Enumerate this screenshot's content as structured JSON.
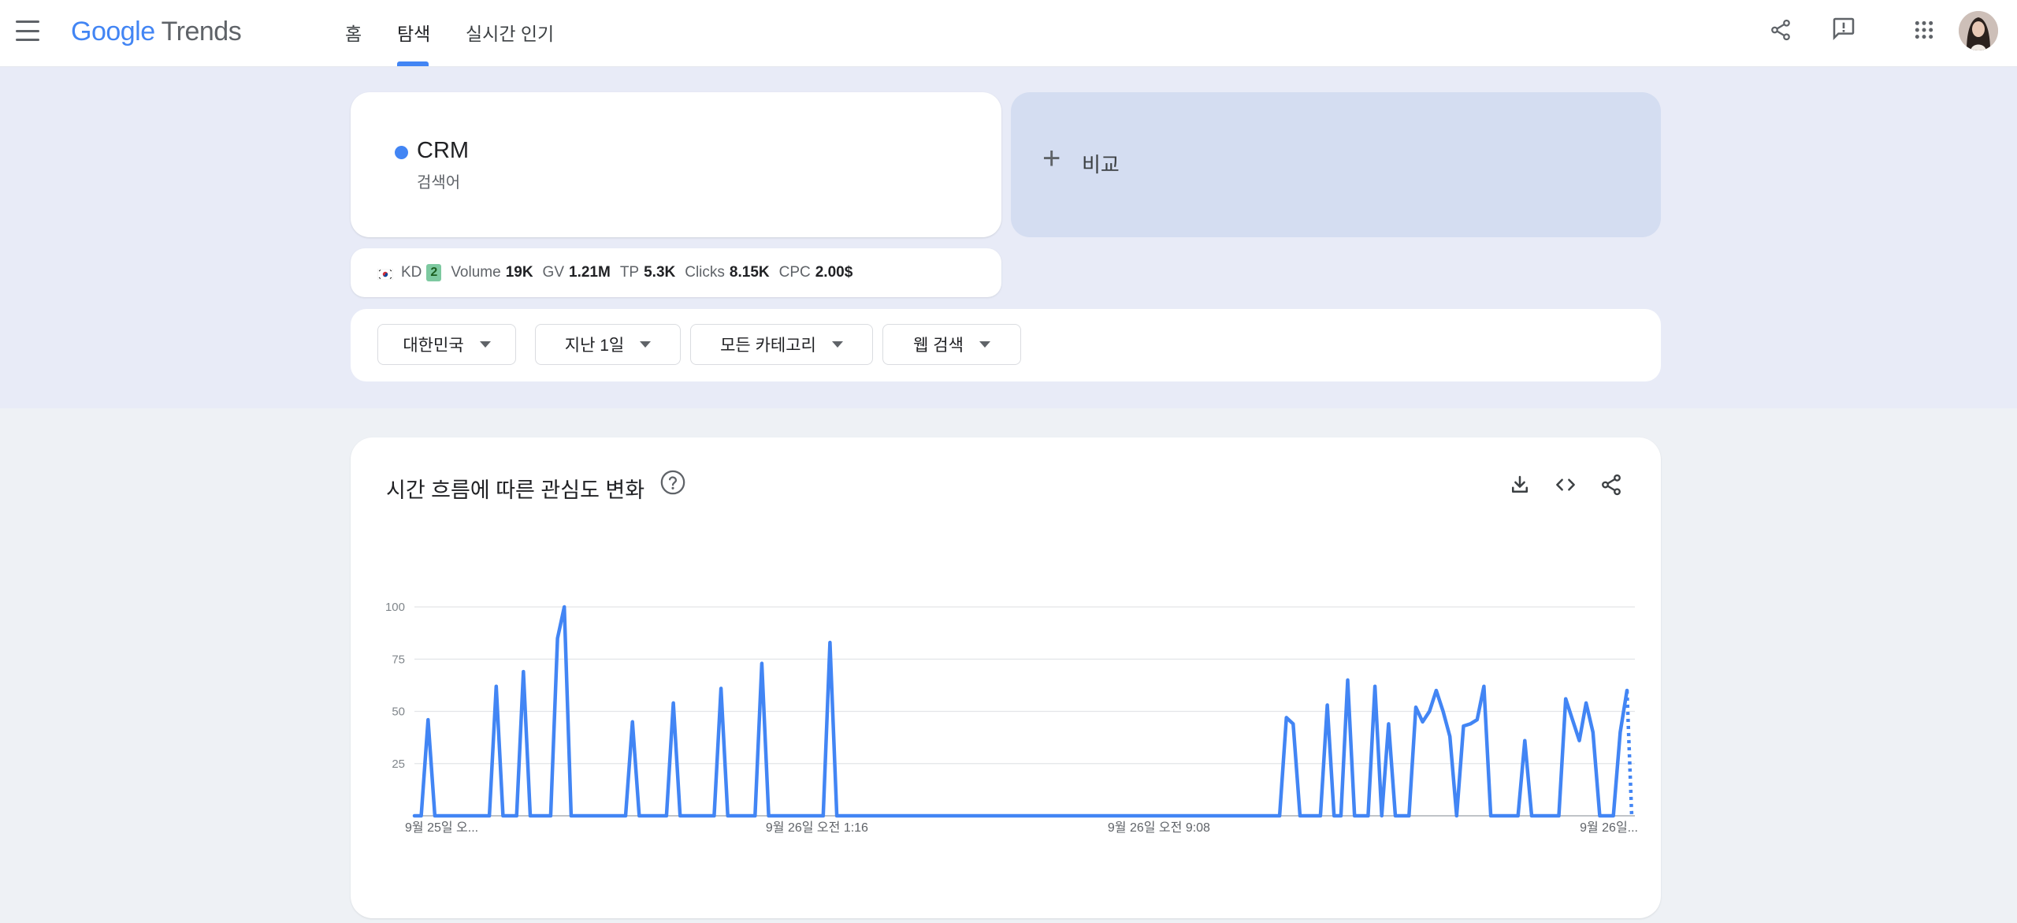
{
  "header": {
    "logo_google": "Google",
    "logo_product": "Trends",
    "tabs": [
      {
        "label": "홈",
        "active": false
      },
      {
        "label": "탐색",
        "active": true
      },
      {
        "label": "실시간 인기",
        "active": false
      }
    ],
    "icons": [
      "share-icon",
      "feedback-icon",
      "apps-grid-icon",
      "avatar"
    ]
  },
  "search": {
    "term": {
      "name": "CRM",
      "type": "검색어",
      "color": "#4285f4"
    },
    "compare_label": "비교"
  },
  "keyword_metrics": {
    "country_flag": "kr-flag-icon",
    "kd_label": "KD",
    "kd_value": "2",
    "volume_label": "Volume",
    "volume_value": "19K",
    "gv_label": "GV",
    "gv_value": "1.21M",
    "tp_label": "TP",
    "tp_value": "5.3K",
    "clicks_label": "Clicks",
    "clicks_value": "8.15K",
    "cpc_label": "CPC",
    "cpc_value": "2.00$"
  },
  "filters": [
    {
      "label": "대한민국"
    },
    {
      "label": "지난 1일"
    },
    {
      "label": "모든 카테고리"
    },
    {
      "label": "웹 검색"
    }
  ],
  "chart_card": {
    "title": "시간 흐름에 따른 관심도 변화",
    "icons": [
      "help-icon",
      "download-icon",
      "embed-code-icon",
      "share-icon"
    ]
  },
  "chart_data": {
    "type": "line",
    "title": "",
    "xlabel": "",
    "ylabel": "",
    "ylim": [
      0,
      100
    ],
    "yticks": [
      25,
      50,
      75,
      100
    ],
    "grid": true,
    "x_tick_labels": [
      "9월 25일 오...",
      "9월 26일 오전 1:16",
      "9월 26일 오전 9:08",
      "9월 26일..."
    ],
    "series": [
      {
        "color": "#4285f4",
        "values": [
          0,
          0,
          46,
          0,
          0,
          0,
          0,
          0,
          0,
          0,
          0,
          0,
          62,
          0,
          0,
          0,
          69,
          0,
          0,
          0,
          0,
          85,
          100,
          0,
          0,
          0,
          0,
          0,
          0,
          0,
          0,
          0,
          45,
          0,
          0,
          0,
          0,
          0,
          54,
          0,
          0,
          0,
          0,
          0,
          0,
          61,
          0,
          0,
          0,
          0,
          0,
          73,
          0,
          0,
          0,
          0,
          0,
          0,
          0,
          0,
          0,
          83,
          0,
          0,
          0,
          0,
          0,
          0,
          0,
          0,
          0,
          0,
          0,
          0,
          0,
          0,
          0,
          0,
          0,
          0,
          0,
          0,
          0,
          0,
          0,
          0,
          0,
          0,
          0,
          0,
          0,
          0,
          0,
          0,
          0,
          0,
          0,
          0,
          0,
          0,
          0,
          0,
          0,
          0,
          0,
          0,
          0,
          0,
          0,
          0,
          0,
          0,
          0,
          0,
          0,
          0,
          0,
          0,
          0,
          0,
          0,
          0,
          0,
          0,
          0,
          0,
          0,
          0,
          47,
          44,
          0,
          0,
          0,
          0,
          53,
          0,
          0,
          65,
          0,
          0,
          0,
          62,
          0,
          44,
          0,
          0,
          0,
          52,
          45,
          50,
          60,
          50,
          38,
          0,
          43,
          44,
          46,
          62,
          0,
          0,
          0,
          0,
          0,
          36,
          0,
          0,
          0,
          0,
          0,
          56,
          46,
          36,
          54,
          40,
          0,
          0,
          0,
          40,
          60
        ],
        "partial_tail": [
          60,
          0
        ]
      }
    ]
  }
}
